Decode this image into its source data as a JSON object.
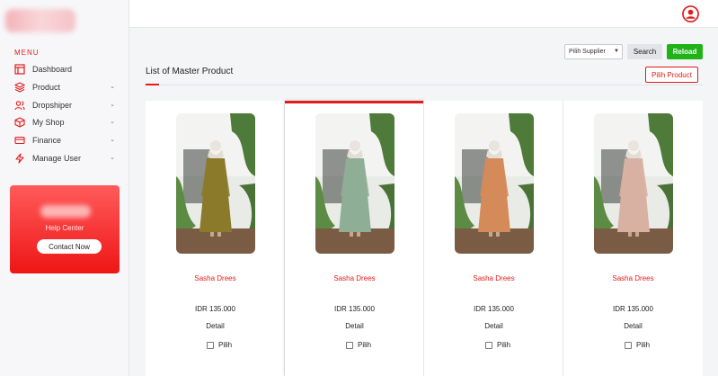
{
  "sidebar": {
    "menu_title": "MENU",
    "items": [
      {
        "label": "Dashboard",
        "icon": "dashboard-icon",
        "has_chevron": false
      },
      {
        "label": "Product",
        "icon": "layers-icon",
        "has_chevron": true
      },
      {
        "label": "Dropshiper",
        "icon": "users-icon",
        "has_chevron": true
      },
      {
        "label": "My Shop",
        "icon": "box-icon",
        "has_chevron": true
      },
      {
        "label": "Finance",
        "icon": "credit-card-icon",
        "has_chevron": true
      },
      {
        "label": "Manage User",
        "icon": "lightning-icon",
        "has_chevron": true
      }
    ],
    "help": {
      "text": "Help Center",
      "button": "Contact Now"
    }
  },
  "toolbar": {
    "supplier_select": "Pilih Supplier",
    "search_label": "Search",
    "reload_label": "Reload"
  },
  "main": {
    "title": "List of Master Product",
    "pilih_product_label": "Pilih Product"
  },
  "products": [
    {
      "name": "Sasha Drees",
      "price": "IDR 135.000",
      "detail": "Detail",
      "pilih": "Pilih",
      "dress_color": "#8a7a2a"
    },
    {
      "name": "Sasha Drees",
      "price": "IDR 135.000",
      "detail": "Detail",
      "pilih": "Pilih",
      "dress_color": "#8fae96"
    },
    {
      "name": "Sasha Drees",
      "price": "IDR 135.000",
      "detail": "Detail",
      "pilih": "Pilih",
      "dress_color": "#d58a5a"
    },
    {
      "name": "Sasha Drees",
      "price": "IDR 135.000",
      "detail": "Detail",
      "pilih": "Pilih",
      "dress_color": "#d9b1a3"
    }
  ],
  "colors": {
    "accent": "#e21c1c",
    "reload": "#1fb317"
  }
}
